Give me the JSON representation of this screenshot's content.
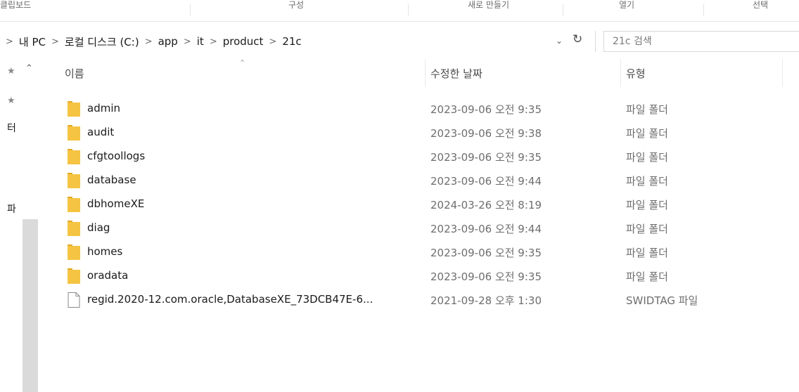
{
  "ribbon": {
    "groups": [
      "클립보드",
      "구성",
      "새로 만들기",
      "열기",
      "선택"
    ]
  },
  "address": {
    "breadcrumbs": [
      "내 PC",
      "로컬 디스크 (C:)",
      "app",
      "it",
      "product",
      "21c"
    ],
    "search_placeholder": "21c 검색"
  },
  "nav": {
    "labels": [
      "터",
      "파"
    ]
  },
  "columns": {
    "name": "이름",
    "date": "수정한 날짜",
    "type": "유형"
  },
  "files": [
    {
      "name": "admin",
      "date": "2023-09-06 오전 9:35",
      "type": "파일 폴더",
      "kind": "folder"
    },
    {
      "name": "audit",
      "date": "2023-09-06 오전 9:38",
      "type": "파일 폴더",
      "kind": "folder"
    },
    {
      "name": "cfgtoollogs",
      "date": "2023-09-06 오전 9:35",
      "type": "파일 폴더",
      "kind": "folder"
    },
    {
      "name": "database",
      "date": "2023-09-06 오전 9:44",
      "type": "파일 폴더",
      "kind": "folder"
    },
    {
      "name": "dbhomeXE",
      "date": "2024-03-26 오전 8:19",
      "type": "파일 폴더",
      "kind": "folder"
    },
    {
      "name": "diag",
      "date": "2023-09-06 오전 9:44",
      "type": "파일 폴더",
      "kind": "folder"
    },
    {
      "name": "homes",
      "date": "2023-09-06 오전 9:35",
      "type": "파일 폴더",
      "kind": "folder"
    },
    {
      "name": "oradata",
      "date": "2023-09-06 오전 9:35",
      "type": "파일 폴더",
      "kind": "folder"
    },
    {
      "name": "regid.2020-12.com.oracle,DatabaseXE_73DCB47E-6...",
      "date": "2021-09-28 오후 1:30",
      "type": "SWIDTAG 파일",
      "kind": "file"
    }
  ],
  "colors": {
    "folder": "#f5c443",
    "folder_dark": "#e2a922",
    "file_border": "#8a8a8a"
  }
}
